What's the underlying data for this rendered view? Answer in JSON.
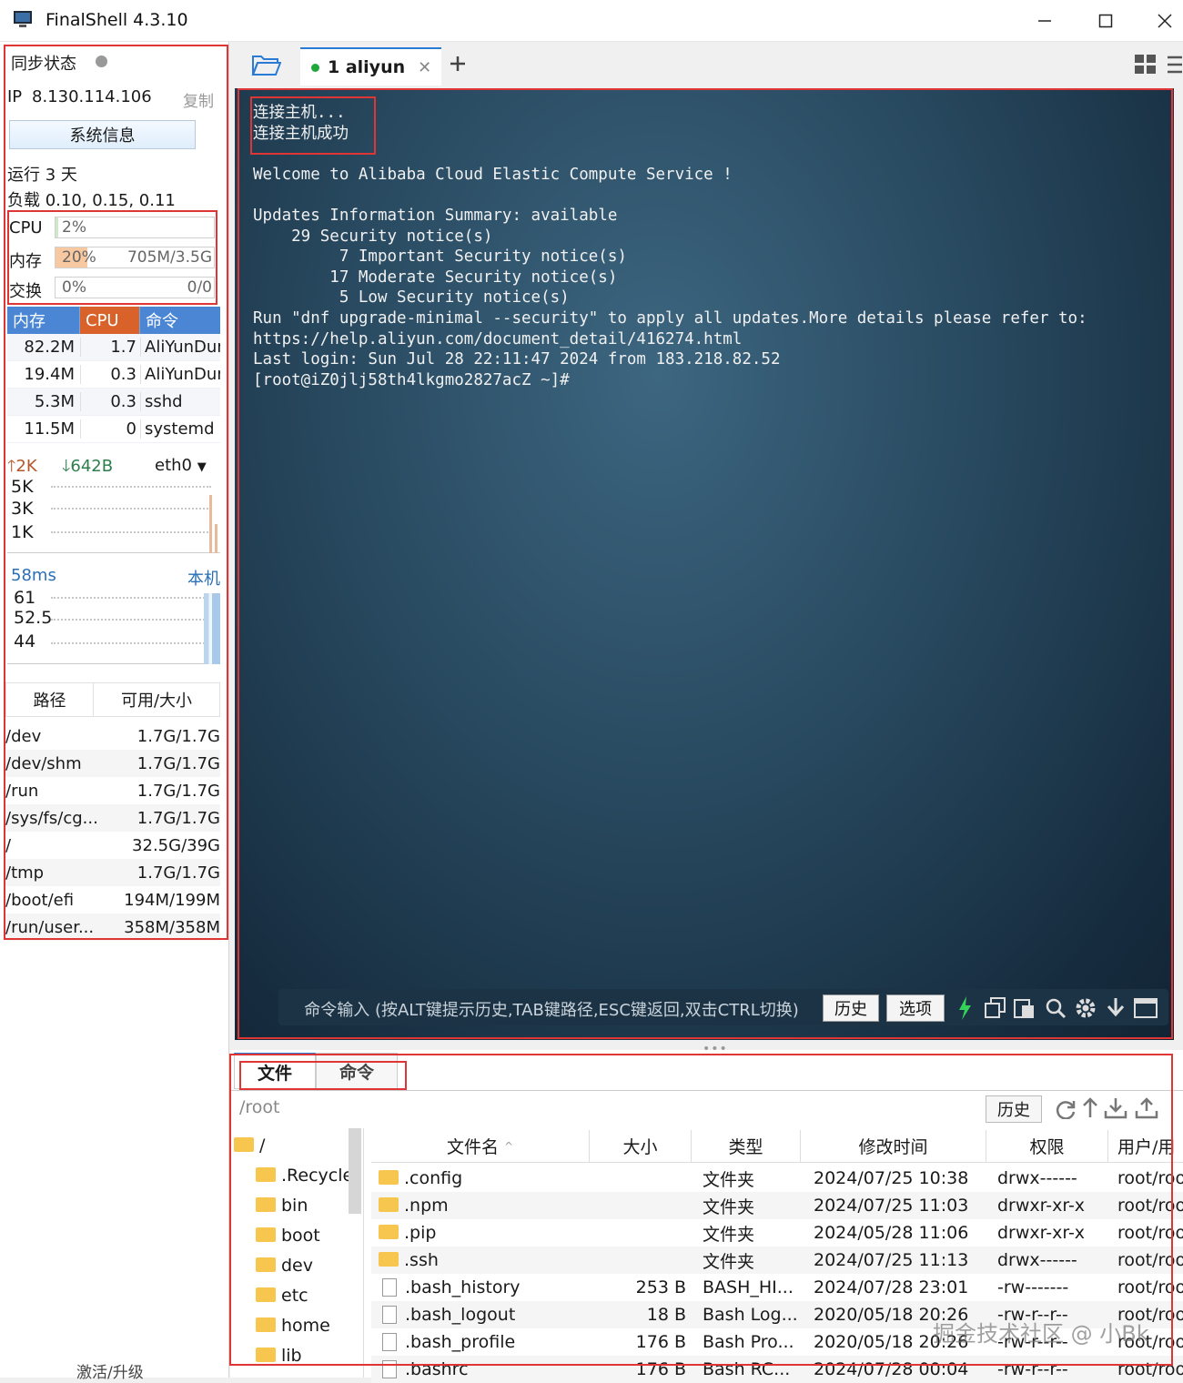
{
  "window": {
    "title": "FinalShell 4.3.10"
  },
  "sidebar": {
    "sync_label": "同步状态",
    "ip_label": "IP",
    "ip": "8.130.114.106",
    "copy_label": "复制",
    "sysinfo_button": "系统信息",
    "uptime": "运行 3 天",
    "load": "负载 0.10, 0.15, 0.11",
    "cpu": {
      "label": "CPU",
      "percent": "2%",
      "fraction": 0.02
    },
    "mem": {
      "label": "内存",
      "percent": "20%",
      "value": "705M/3.5G",
      "fraction": 0.2
    },
    "swap": {
      "label": "交换",
      "percent": "0%",
      "value": "0/0",
      "fraction": 0
    },
    "proc_headers": [
      "内存",
      "CPU",
      "命令"
    ],
    "processes": [
      {
        "mem": "82.2M",
        "cpu": "1.7",
        "cmd": "AliYunDun"
      },
      {
        "mem": "19.4M",
        "cpu": "0.3",
        "cmd": "AliYunDun"
      },
      {
        "mem": "5.3M",
        "cpu": "0.3",
        "cmd": "sshd"
      },
      {
        "mem": "11.5M",
        "cpu": "0",
        "cmd": "systemd"
      }
    ],
    "net": {
      "up": "2K",
      "down": "642B",
      "iface": "eth0",
      "ticks": [
        "5K",
        "3K",
        "1K"
      ]
    },
    "ping": {
      "latency": "58ms",
      "target": "本机",
      "ticks": [
        "61",
        "52.5",
        "44"
      ]
    },
    "disk_headers": [
      "路径",
      "可用/大小"
    ],
    "disks": [
      {
        "path": "/dev",
        "size": "1.7G/1.7G"
      },
      {
        "path": "/dev/shm",
        "size": "1.7G/1.7G"
      },
      {
        "path": "/run",
        "size": "1.7G/1.7G"
      },
      {
        "path": "/sys/fs/cg...",
        "size": "1.7G/1.7G"
      },
      {
        "path": "/",
        "size": "32.5G/39G"
      },
      {
        "path": "/tmp",
        "size": "1.7G/1.7G"
      },
      {
        "path": "/boot/efi",
        "size": "194M/199M"
      },
      {
        "path": "/run/user...",
        "size": "358M/358M"
      }
    ],
    "activate": "激活/升级"
  },
  "tabs": [
    {
      "label": "1 aliyun"
    }
  ],
  "terminal": {
    "lines": [
      "连接主机...",
      "连接主机成功",
      "",
      "Welcome to Alibaba Cloud Elastic Compute Service !",
      "",
      "Updates Information Summary: available",
      "    29 Security notice(s)",
      "         7 Important Security notice(s)",
      "        17 Moderate Security notice(s)",
      "         5 Low Security notice(s)",
      "Run \"dnf upgrade-minimal --security\" to apply all updates.More details please refer to:",
      "https://help.aliyun.com/document_detail/416274.html",
      "Last login: Sun Jul 28 22:11:47 2024 from 183.218.82.52",
      "[root@iZ0jlj58th4lkgmo2827acZ ~]#"
    ],
    "cmd_placeholder": "命令输入 (按ALT键提示历史,TAB键路径,ESC键返回,双击CTRL切换)",
    "history_btn": "历史",
    "options_btn": "选项"
  },
  "files": {
    "tabs": [
      "文件",
      "命令"
    ],
    "path": "/root",
    "history_btn": "历史",
    "tree": [
      "/",
      ".Recycle",
      "bin",
      "boot",
      "dev",
      "etc",
      "home",
      "lib"
    ],
    "headers": [
      "文件名",
      "大小",
      "类型",
      "修改时间",
      "权限",
      "用户/用"
    ],
    "rows": [
      {
        "name": ".config",
        "size": "",
        "type": "文件夹",
        "mtime": "2024/07/25 10:38",
        "perm": "drwx------",
        "user": "root/root",
        "folder": true
      },
      {
        "name": ".npm",
        "size": "",
        "type": "文件夹",
        "mtime": "2024/07/25 11:03",
        "perm": "drwxr-xr-x",
        "user": "root/root",
        "folder": true
      },
      {
        "name": ".pip",
        "size": "",
        "type": "文件夹",
        "mtime": "2024/05/28 11:06",
        "perm": "drwxr-xr-x",
        "user": "root/root",
        "folder": true
      },
      {
        "name": ".ssh",
        "size": "",
        "type": "文件夹",
        "mtime": "2024/07/25 11:13",
        "perm": "drwx------",
        "user": "root/root",
        "folder": true
      },
      {
        "name": ".bash_history",
        "size": "253 B",
        "type": "BASH_HI...",
        "mtime": "2024/07/28 23:01",
        "perm": "-rw-------",
        "user": "root/root",
        "folder": false
      },
      {
        "name": ".bash_logout",
        "size": "18 B",
        "type": "Bash Log...",
        "mtime": "2020/05/18 20:26",
        "perm": "-rw-r--r--",
        "user": "root/root",
        "folder": false
      },
      {
        "name": ".bash_profile",
        "size": "176 B",
        "type": "Bash Pro...",
        "mtime": "2020/05/18 20:26",
        "perm": "-rw-r--r--",
        "user": "root/root",
        "folder": false
      },
      {
        "name": ".bashrc",
        "size": "176 B",
        "type": "Bash RC...",
        "mtime": "2024/07/28 00:04",
        "perm": "-rw-r--r--",
        "user": "root/root",
        "folder": false
      }
    ]
  },
  "watermark": "掘金技术社区 @ 小Bk",
  "colors": {
    "accent": "#2a7bd5",
    "highlight": "#e03535",
    "upload": "#c0392b",
    "download": "#2e8b57",
    "terminal_bg": "#2a4c63"
  }
}
